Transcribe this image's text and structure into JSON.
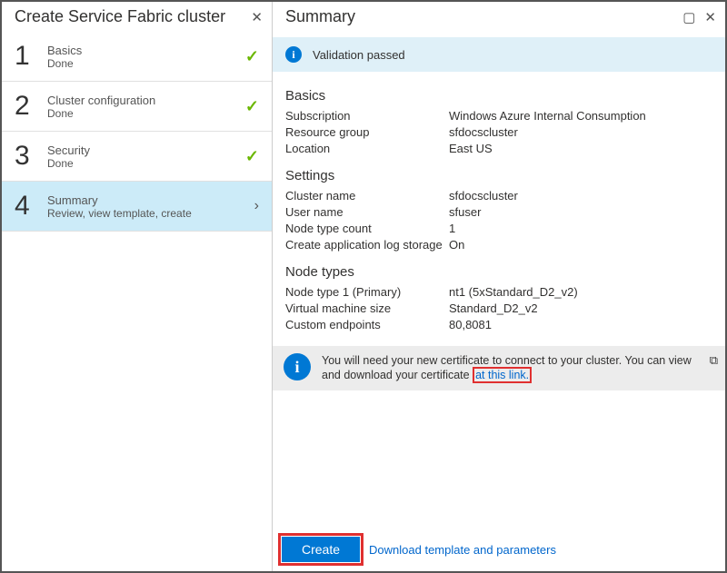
{
  "left": {
    "title": "Create Service Fabric cluster",
    "steps": [
      {
        "num": "1",
        "title": "Basics",
        "sub": "Done",
        "done": true
      },
      {
        "num": "2",
        "title": "Cluster configuration",
        "sub": "Done",
        "done": true
      },
      {
        "num": "3",
        "title": "Security",
        "sub": "Done",
        "done": true
      },
      {
        "num": "4",
        "title": "Summary",
        "sub": "Review, view template, create",
        "active": true
      }
    ]
  },
  "right": {
    "title": "Summary",
    "validation": "Validation passed",
    "sections": {
      "basics": {
        "heading": "Basics",
        "rows": [
          [
            "Subscription",
            "Windows Azure Internal Consumption"
          ],
          [
            "Resource group",
            "sfdocscluster"
          ],
          [
            "Location",
            "East US"
          ]
        ]
      },
      "settings": {
        "heading": "Settings",
        "rows": [
          [
            "Cluster name",
            "sfdocscluster"
          ],
          [
            "User name",
            "sfuser"
          ],
          [
            "Node type count",
            "1"
          ],
          [
            "Create application log storage",
            "On"
          ]
        ]
      },
      "nodetypes": {
        "heading": "Node types",
        "rows": [
          [
            "Node type 1 (Primary)",
            "nt1 (5xStandard_D2_v2)"
          ],
          [
            "Virtual machine size",
            "Standard_D2_v2"
          ],
          [
            "Custom endpoints",
            "80,8081"
          ]
        ]
      }
    },
    "cert_message_pre": "You will need your new certificate to connect to your cluster. You can view and download your certificate ",
    "cert_link_text": "at this link.",
    "create_label": "Create",
    "download_label": "Download template and parameters"
  }
}
